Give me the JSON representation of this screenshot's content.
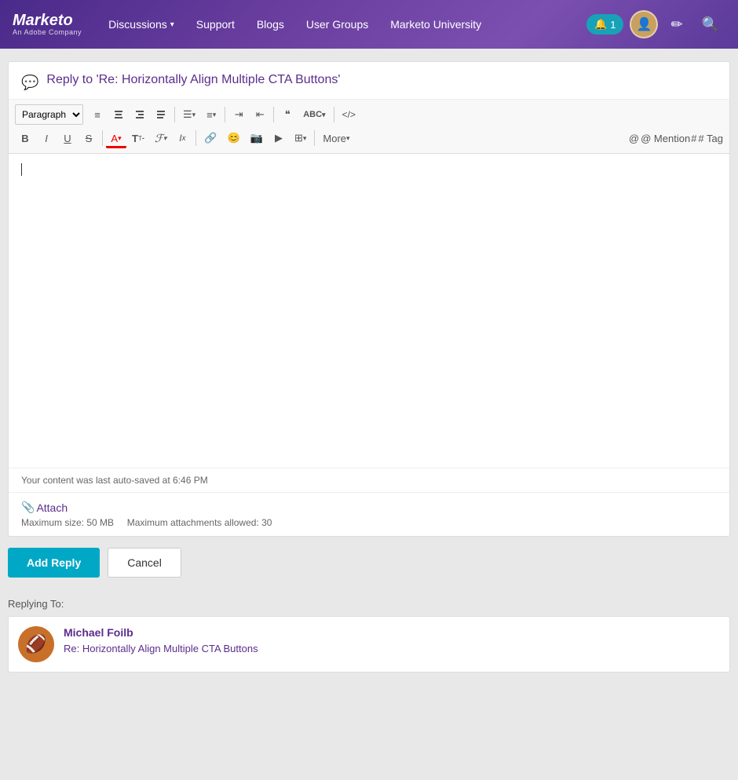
{
  "app": {
    "logo_text": "Marketo",
    "logo_sub": "An Adobe Company"
  },
  "navbar": {
    "discussions_label": "Discussions",
    "support_label": "Support",
    "blogs_label": "Blogs",
    "user_groups_label": "User Groups",
    "university_label": "Marketo University",
    "notif_count": "1",
    "search_icon": "🔍",
    "edit_icon": "✏"
  },
  "reply_box": {
    "title_static": "Reply to '",
    "title_link": "Re: Horizontally Align Multiple CTA Buttons",
    "title_close": "'",
    "toolbar": {
      "paragraph_label": "Paragraph",
      "align_left": "≡",
      "align_center": "≡",
      "align_right": "≡",
      "align_justify": "≡",
      "bullet_list": "☰",
      "ordered_list": "☰",
      "indent": "→",
      "outdent": "←",
      "blockquote": "❝",
      "spellcheck": "ABC",
      "code": "</>",
      "bold": "B",
      "italic": "I",
      "underline": "U",
      "strikethrough": "S",
      "font_color": "A",
      "text_size": "T",
      "font_family": "F",
      "clear_format": "Ix",
      "link": "🔗",
      "emoji": "😊",
      "image": "📷",
      "video": "▶",
      "table": "⊞",
      "more_label": "More",
      "mention_label": "@ Mention",
      "tag_label": "# Tag"
    },
    "autosave_text": "Your content was last auto-saved at 6:46 PM",
    "attach_icon": "📎",
    "attach_label": "Attach",
    "attach_max_size": "Maximum size: 50 MB",
    "attach_max_count": "Maximum attachments allowed: 30",
    "add_reply_label": "Add Reply",
    "cancel_label": "Cancel"
  },
  "replying_to": {
    "label": "Replying To:",
    "author": "Michael Foilb",
    "subject": "Re: Horizontally Align Multiple CTA Buttons",
    "avatar_emoji": "🏈"
  }
}
